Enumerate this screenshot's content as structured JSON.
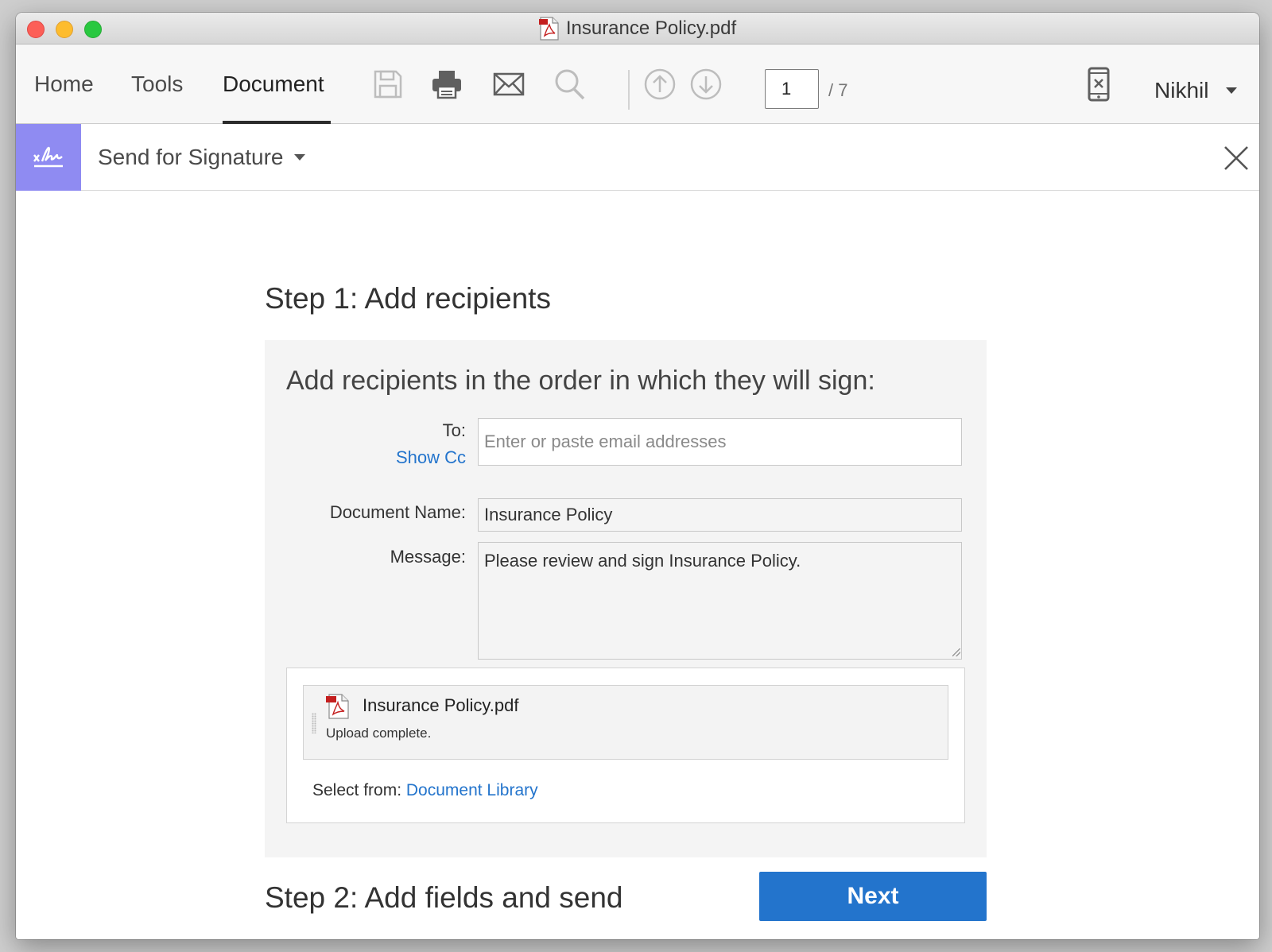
{
  "window": {
    "title": "Insurance Policy.pdf"
  },
  "toolbar": {
    "tabs": [
      {
        "label": "Home"
      },
      {
        "label": "Tools"
      },
      {
        "label": "Document",
        "active": true
      }
    ],
    "icons": [
      "save-icon",
      "print-icon",
      "mail-icon",
      "search-icon",
      "previous-page-icon",
      "next-page-icon",
      "mobile-link-icon"
    ],
    "page_current": "1",
    "page_total": "/ 7",
    "user_name": "Nikhil"
  },
  "sign_panel": {
    "title": "Send for Signature",
    "badge_color": "#8f8bf2"
  },
  "step1": {
    "heading": "Step 1: Add recipients",
    "subheading": "Add recipients in the order in which they will sign:",
    "to_label": "To:",
    "show_cc": "Show Cc",
    "to_placeholder": "Enter or paste email addresses",
    "document_name_label": "Document Name:",
    "document_name_value": "Insurance Policy",
    "message_label": "Message:",
    "message_value": "Please review and sign Insurance Policy.",
    "file": {
      "name": "Insurance Policy.pdf",
      "status": "Upload complete."
    },
    "select_from_label": "Select from:",
    "document_library": "Document Library"
  },
  "step2": {
    "heading": "Step 2: Add fields and send",
    "next_label": "Next",
    "accent_color": "#2374cc"
  }
}
